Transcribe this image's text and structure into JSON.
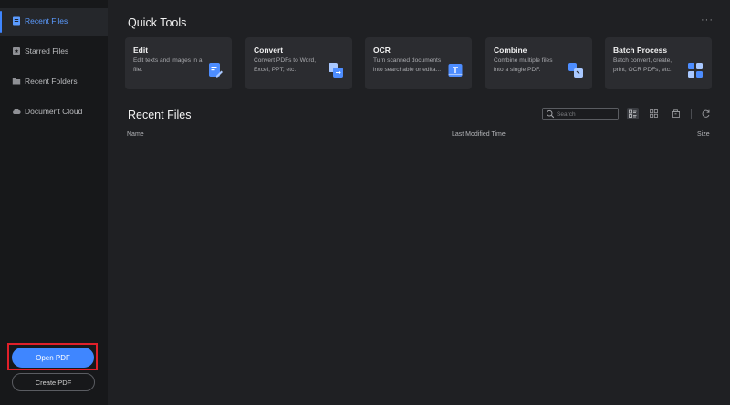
{
  "sidebar": {
    "items": [
      {
        "label": "Recent Files",
        "icon": "recent-files-icon",
        "active": true
      },
      {
        "label": "Starred Files",
        "icon": "star-icon",
        "active": false
      },
      {
        "label": "Recent Folders",
        "icon": "folder-icon",
        "active": false
      },
      {
        "label": "Document Cloud",
        "icon": "cloud-icon",
        "active": false
      }
    ],
    "open_pdf": "Open PDF",
    "create_pdf": "Create PDF"
  },
  "quick_tools": {
    "title": "Quick Tools",
    "more": "···",
    "cards": [
      {
        "title": "Edit",
        "desc": "Edit texts and images in a file.",
        "icon": "edit-icon"
      },
      {
        "title": "Convert",
        "desc": "Convert PDFs to Word, Excel, PPT, etc.",
        "icon": "convert-icon"
      },
      {
        "title": "OCR",
        "desc": "Turn scanned documents into searchable or edita...",
        "icon": "ocr-icon"
      },
      {
        "title": "Combine",
        "desc": "Combine multiple files into a single PDF.",
        "icon": "combine-icon"
      },
      {
        "title": "Batch Process",
        "desc": "Batch convert, create, print, OCR PDFs, etc.",
        "icon": "batch-icon"
      }
    ]
  },
  "recent": {
    "title": "Recent Files",
    "search_placeholder": "Search",
    "columns": {
      "name": "Name",
      "modified": "Last Modified Time",
      "size": "Size"
    }
  },
  "colors": {
    "accent": "#3f86ff",
    "highlight": "#e0202a",
    "background": "#1f2023",
    "sidebar": "#17181a"
  }
}
